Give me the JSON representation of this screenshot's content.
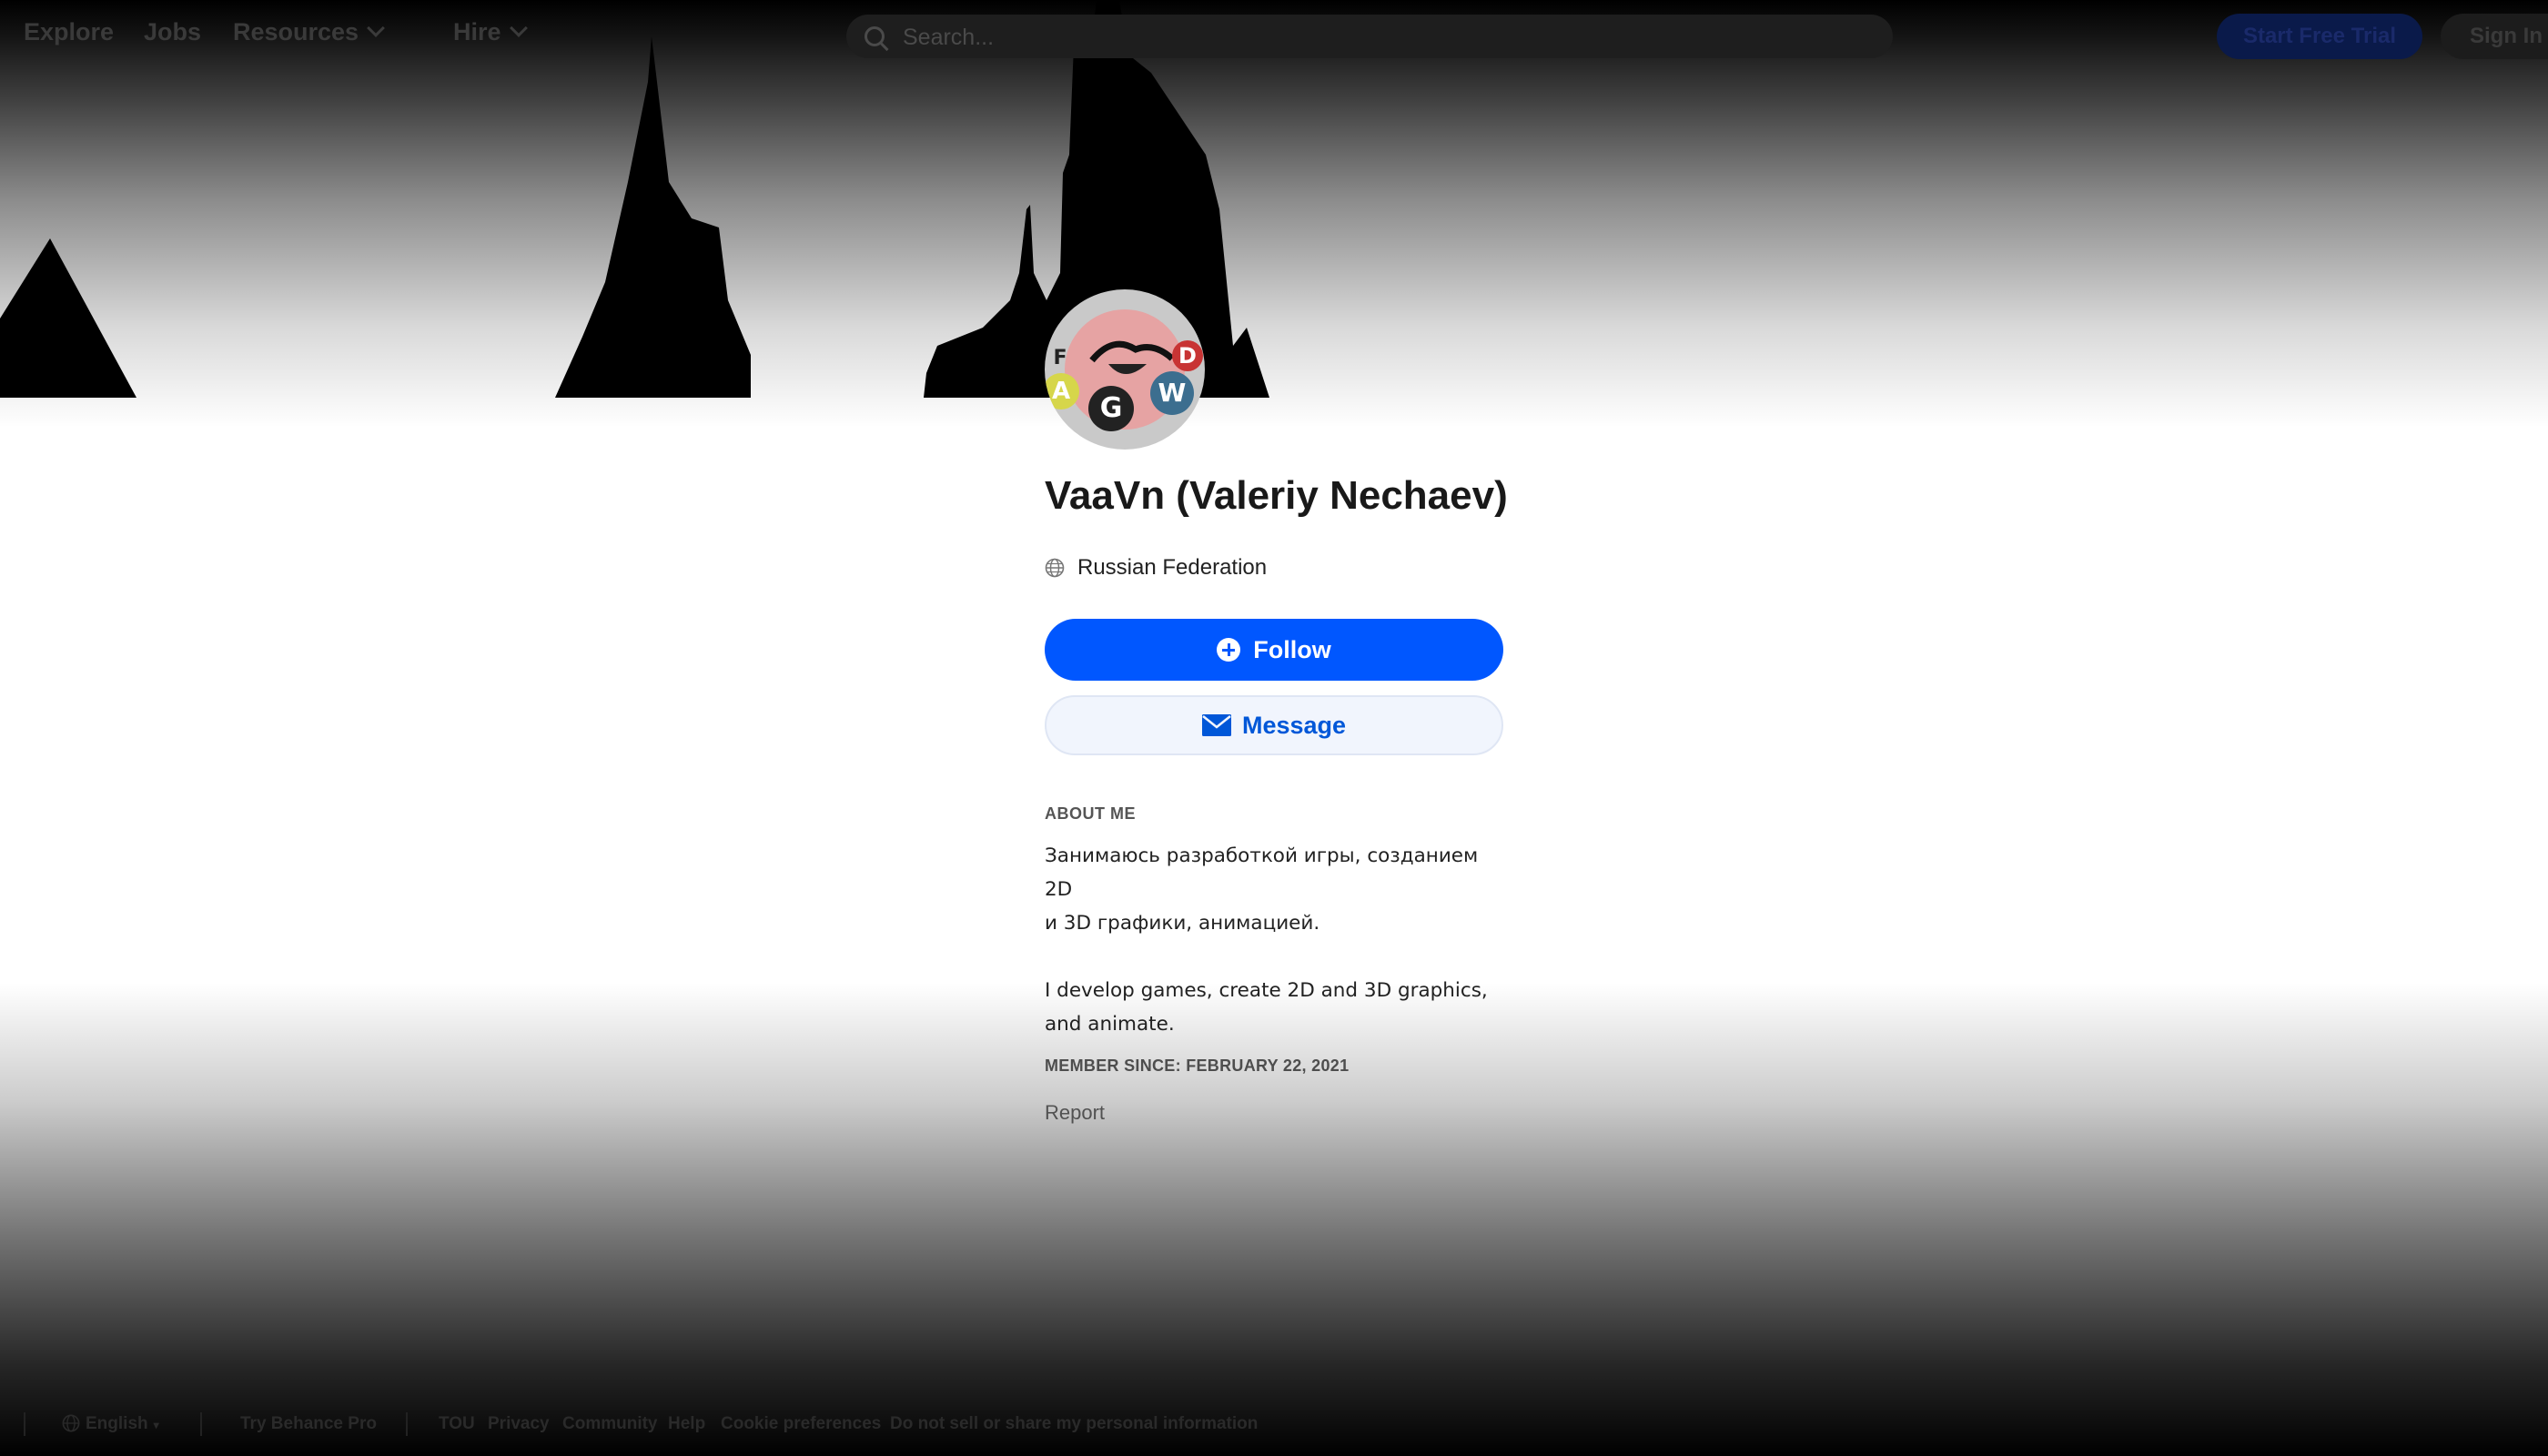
{
  "header": {
    "nav": [
      "Explore",
      "Jobs",
      "Resources",
      "Hire"
    ],
    "search_placeholder": "Search...",
    "trial_label": "Start Free Trial",
    "signin_label": "Sign In"
  },
  "avatar": {
    "letters": [
      "A",
      "G",
      "W",
      "D",
      "F"
    ]
  },
  "profile": {
    "name": "VaaVn (Valeriy Nechaev)",
    "location": "Russian Federation",
    "follow_label": "Follow",
    "message_label": "Message",
    "about_label": "ABOUT ME",
    "about_text": "Занимаюсь разработкой игры, созданием 2D\nи 3D графики, анимацией.\n\nI develop games, create 2D and 3D graphics,\nand animate.",
    "member_since": "MEMBER SINCE: FEBRUARY 22, 2021",
    "report_label": "Report"
  },
  "footer": {
    "language": "English",
    "try_pro": "Try Behance Pro",
    "links": [
      "TOU",
      "Privacy",
      "Community",
      "Help",
      "Cookie preferences",
      "Do not sell or share my personal information"
    ]
  },
  "icons": [
    "search-icon",
    "chevron-down-icon",
    "globe-icon",
    "plus-circle-icon",
    "envelope-icon"
  ],
  "colors": {
    "accent": "#0057ff",
    "message_text": "#0057d8",
    "message_bg": "#f1f5fd",
    "avatar_face": "#e6a3a3"
  }
}
